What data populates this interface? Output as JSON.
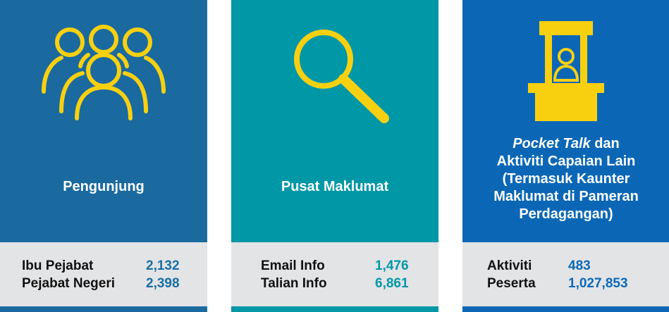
{
  "colors": {
    "card_1_bg": "#1a6aa0",
    "card_2_bg": "#0097a7",
    "card_3_bg": "#0b67b6",
    "icon_color": "#f9d010",
    "stats_bg": "#e3e4e6"
  },
  "cards": [
    {
      "icon": "people-group-icon",
      "title": "Pengunjung",
      "stats": [
        {
          "label": "Ibu Pejabat",
          "value": "2,132"
        },
        {
          "label": "Pejabat Negeri",
          "value": "2,398"
        }
      ]
    },
    {
      "icon": "magnifier-icon",
      "title": "Pusat Maklumat",
      "stats": [
        {
          "label": "Email Info",
          "value": "1,476"
        },
        {
          "label": "Talian Info",
          "value": "6,861"
        }
      ]
    },
    {
      "icon": "booth-counter-icon",
      "title_italic": "Pocket Talk",
      "title_line_1_rest": " dan",
      "title_line_2": "Aktiviti Capaian Lain",
      "title_line_3": "(Termasuk Kaunter",
      "title_line_4": "Maklumat di Pameran",
      "title_line_5": "Perdagangan)",
      "stats": [
        {
          "label": "Aktiviti",
          "value": "483"
        },
        {
          "label": "Peserta",
          "value": "1,027,853"
        }
      ]
    }
  ]
}
